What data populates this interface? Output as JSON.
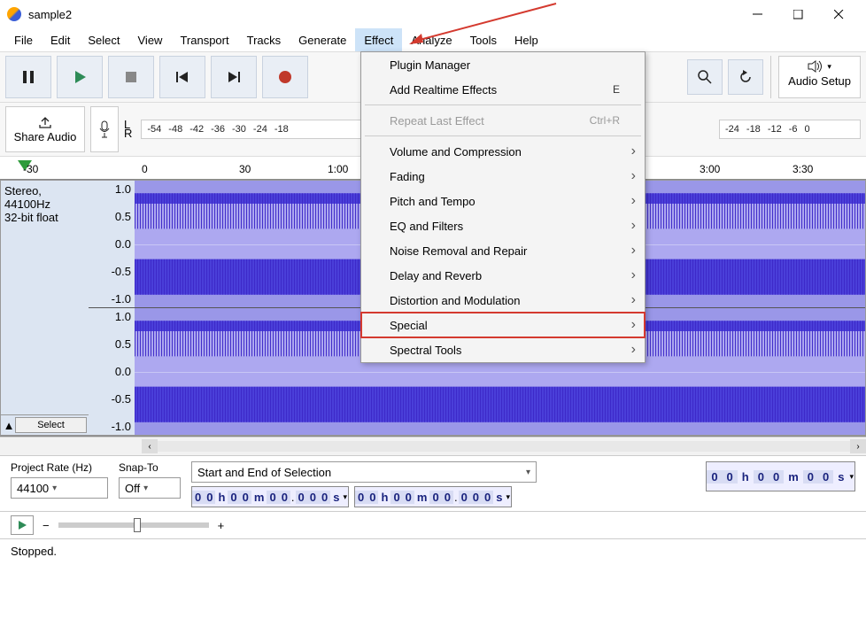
{
  "window": {
    "title": "sample2"
  },
  "menubar": [
    "File",
    "Edit",
    "Select",
    "View",
    "Transport",
    "Tracks",
    "Generate",
    "Effect",
    "Analyze",
    "Tools",
    "Help"
  ],
  "menubar_active": "Effect",
  "toolbar": {
    "audio_setup": "Audio Setup",
    "share": "Share Audio"
  },
  "meter_ticks": [
    "-54",
    "-48",
    "-42",
    "-36",
    "-30",
    "-24",
    "-18"
  ],
  "meter_ticks_right": [
    "-24",
    "-18",
    "-12",
    "-6",
    "0"
  ],
  "lr": {
    "l": "L",
    "r": "R"
  },
  "ruler": {
    "neg": "-30",
    "t0": "0",
    "t1": "30",
    "t2": "1:00",
    "t3": "3:00",
    "t4": "3:30"
  },
  "track": {
    "format": "Stereo, 44100Hz",
    "depth": "32-bit float",
    "select": "Select",
    "scales_top": [
      "1.0",
      "0.5",
      "0.0",
      "-0.5",
      "-1.0"
    ],
    "scales_bot": [
      "1.0",
      "0.5",
      "0.0",
      "-0.5",
      "-1.0"
    ]
  },
  "effect_menu": {
    "items": [
      {
        "label": "Plugin Manager",
        "sub": false
      },
      {
        "label": "Add Realtime Effects",
        "sub": false,
        "kb": "E"
      },
      {
        "sep": true
      },
      {
        "label": "Repeat Last Effect",
        "sub": false,
        "kb": "Ctrl+R",
        "disabled": true
      },
      {
        "sep": true
      },
      {
        "label": "Volume and Compression",
        "sub": true
      },
      {
        "label": "Fading",
        "sub": true
      },
      {
        "label": "Pitch and Tempo",
        "sub": true
      },
      {
        "label": "EQ and Filters",
        "sub": true
      },
      {
        "label": "Noise Removal and Repair",
        "sub": true
      },
      {
        "label": "Delay and Reverb",
        "sub": true
      },
      {
        "label": "Distortion and Modulation",
        "sub": true
      },
      {
        "label": "Special",
        "sub": true,
        "hl": true
      },
      {
        "label": "Spectral Tools",
        "sub": true
      }
    ]
  },
  "bottom": {
    "project_rate_label": "Project Rate (Hz)",
    "project_rate": "44100",
    "snap_label": "Snap-To",
    "snap": "Off",
    "range_label": "Start and End of Selection",
    "tc_h": "0",
    "tc_h2": "0",
    "tc_m": "0",
    "tc_m2": "0",
    "tc_s": "0",
    "tc_s2": "0",
    "tc_ms": "0",
    "tc_ms2": "0",
    "tc_ms3": "0",
    "uh": "h",
    "um": "m",
    "us": "s",
    "big_h": "0",
    "big_h2": "0",
    "big_m": "0",
    "big_m2": "0",
    "big_s": "0",
    "big_s2": "0"
  },
  "status": "Stopped.",
  "slider": {
    "minus": "−",
    "plus": "+"
  }
}
